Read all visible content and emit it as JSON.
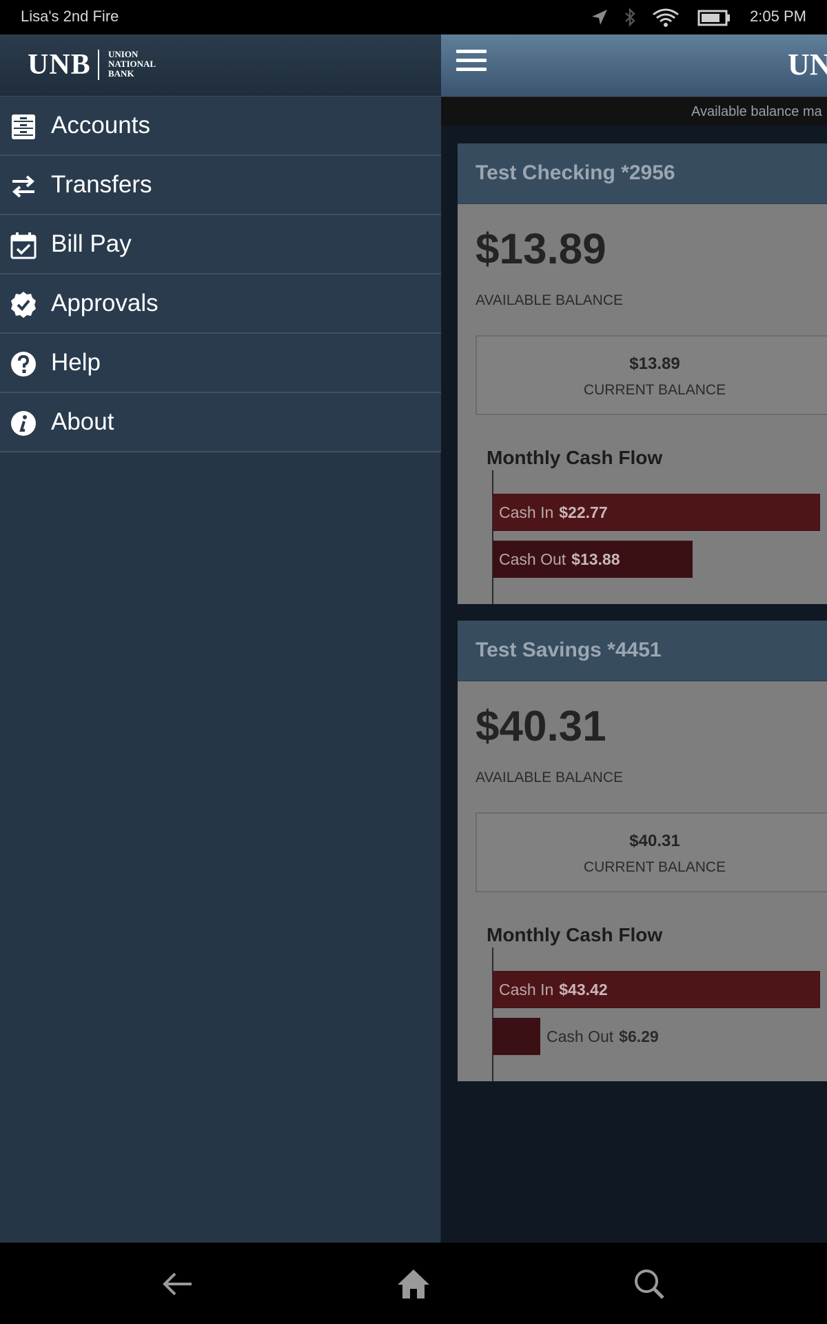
{
  "status_bar": {
    "device_name": "Lisa's 2nd Fire",
    "time": "2:05 PM",
    "icons": [
      "location-icon",
      "bluetooth-icon",
      "wifi-icon",
      "battery-icon"
    ]
  },
  "drawer": {
    "logo": {
      "mark": "UNB",
      "line1": "UNION",
      "line2": "NATIONAL",
      "line3": "BANK"
    },
    "items": [
      {
        "label": "Accounts",
        "icon": "file-cabinet-icon"
      },
      {
        "label": "Transfers",
        "icon": "transfer-arrows-icon"
      },
      {
        "label": "Bill Pay",
        "icon": "calendar-check-icon"
      },
      {
        "label": "Approvals",
        "icon": "badge-check-icon"
      },
      {
        "label": "Help",
        "icon": "question-circle-icon"
      },
      {
        "label": "About",
        "icon": "info-circle-icon"
      }
    ]
  },
  "main": {
    "logo_text": "UN",
    "notice": "Available balance ma",
    "accounts": [
      {
        "title": "Test Checking *2956",
        "available_amount": "$13.89",
        "available_label": "AVAILABLE BALANCE",
        "current_amount": "$13.89",
        "current_label": "CURRENT BALANCE",
        "cash_flow_title": "Monthly Cash Flow",
        "cash_in_label": "Cash In",
        "cash_in_amount": "$22.77",
        "cash_out_label": "Cash Out",
        "cash_out_amount": "$13.88",
        "cash_in_value": 22.77,
        "cash_out_value": 13.88
      },
      {
        "title": "Test Savings *4451",
        "available_amount": "$40.31",
        "available_label": "AVAILABLE BALANCE",
        "current_amount": "$40.31",
        "current_label": "CURRENT BALANCE",
        "cash_flow_title": "Monthly Cash Flow",
        "cash_in_label": "Cash In",
        "cash_in_amount": "$43.42",
        "cash_out_label": "Cash Out",
        "cash_out_amount": "$6.29",
        "cash_in_value": 43.42,
        "cash_out_value": 6.29
      }
    ]
  },
  "nav_bar": {
    "buttons": [
      "back-icon",
      "home-icon",
      "search-icon"
    ]
  },
  "colors": {
    "drawer_bg": "#263647",
    "header_blue": "#4a6884",
    "cash_in_bar": "#4e1518",
    "cash_out_bar": "#3a1014"
  }
}
